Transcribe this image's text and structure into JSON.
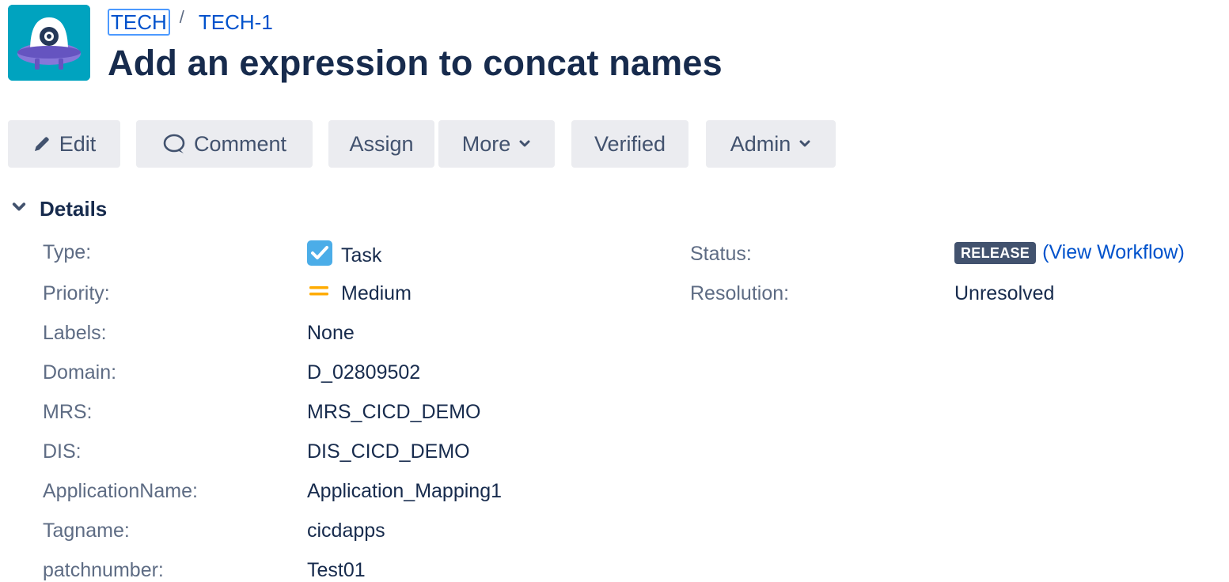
{
  "breadcrumb": {
    "project": "TECH",
    "separator": "/",
    "issue_key": "TECH-1"
  },
  "issue": {
    "title": "Add an expression to concat names"
  },
  "toolbar": {
    "edit": "Edit",
    "comment": "Comment",
    "assign": "Assign",
    "more": "More",
    "verified": "Verified",
    "admin": "Admin"
  },
  "details": {
    "section_title": "Details",
    "left_fields": [
      {
        "label": "Type:",
        "value": "Task",
        "icon": "task-checkbox-icon"
      },
      {
        "label": "Priority:",
        "value": "Medium",
        "icon": "priority-medium-icon"
      },
      {
        "label": "Labels:",
        "value": "None"
      },
      {
        "label": "Domain:",
        "value": "D_02809502"
      },
      {
        "label": "MRS:",
        "value": "MRS_CICD_DEMO"
      },
      {
        "label": "DIS:",
        "value": "DIS_CICD_DEMO"
      },
      {
        "label": "ApplicationName:",
        "value": "Application_Mapping1"
      },
      {
        "label": "Tagname:",
        "value": "cicdapps"
      },
      {
        "label": "patchnumber:",
        "value": "Test01"
      }
    ],
    "right_fields": [
      {
        "label": "Status:",
        "value": "RELEASE",
        "link": "(View Workflow)"
      },
      {
        "label": "Resolution:",
        "value": "Unresolved"
      }
    ]
  },
  "colors": {
    "link": "#0052cc",
    "button_bg": "#ebecf0",
    "status_lozenge": "#42526e",
    "task_icon": "#4bade8",
    "priority_medium": "#ffab00",
    "project_avatar": "#00a3bf"
  }
}
